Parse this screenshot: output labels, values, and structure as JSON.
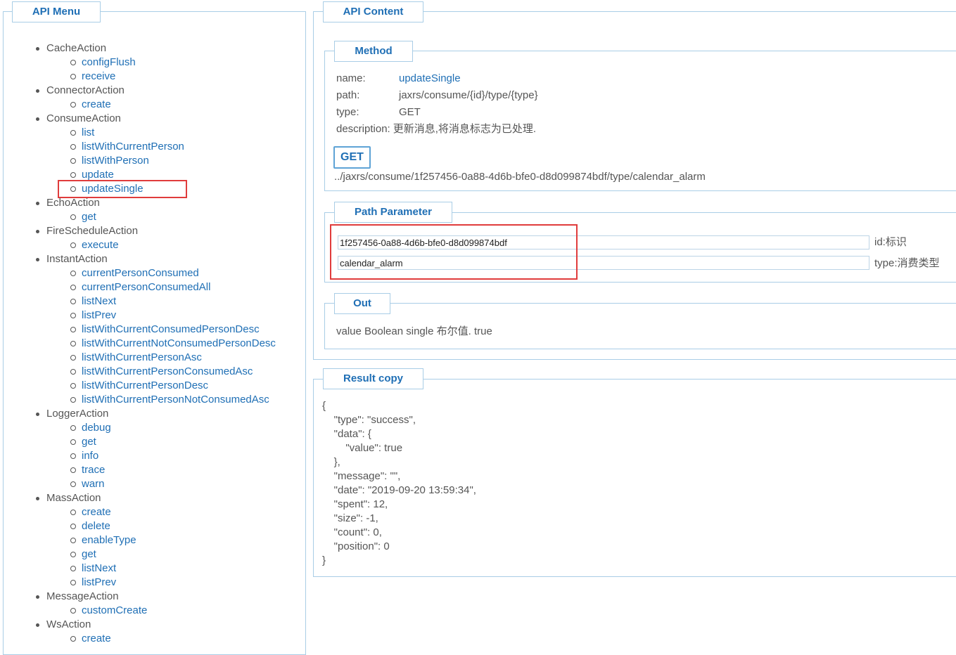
{
  "menu": {
    "title": "API Menu",
    "groups": [
      {
        "label": "CacheAction",
        "items": [
          "configFlush",
          "receive"
        ]
      },
      {
        "label": "ConnectorAction",
        "items": [
          "create"
        ]
      },
      {
        "label": "ConsumeAction",
        "items": [
          "list",
          "listWithCurrentPerson",
          "listWithPerson",
          "update",
          "updateSingle"
        ]
      },
      {
        "label": "EchoAction",
        "items": [
          "get"
        ]
      },
      {
        "label": "FireScheduleAction",
        "items": [
          "execute"
        ]
      },
      {
        "label": "InstantAction",
        "items": [
          "currentPersonConsumed",
          "currentPersonConsumedAll",
          "listNext",
          "listPrev",
          "listWithCurrentConsumedPersonDesc",
          "listWithCurrentNotConsumedPersonDesc",
          "listWithCurrentPersonAsc",
          "listWithCurrentPersonConsumedAsc",
          "listWithCurrentPersonDesc",
          "listWithCurrentPersonNotConsumedAsc"
        ]
      },
      {
        "label": "LoggerAction",
        "items": [
          "debug",
          "get",
          "info",
          "trace",
          "warn"
        ]
      },
      {
        "label": "MassAction",
        "items": [
          "create",
          "delete",
          "enableType",
          "get",
          "listNext",
          "listPrev"
        ]
      },
      {
        "label": "MessageAction",
        "items": [
          "customCreate"
        ]
      },
      {
        "label": "WsAction",
        "items": [
          "create"
        ]
      }
    ]
  },
  "content": {
    "title": "API Content",
    "method": {
      "title": "Method",
      "name_label": "name:",
      "name_value": "updateSingle",
      "path_label": "path:",
      "path_value": "jaxrs/consume/{id}/type/{type}",
      "type_label": "type:",
      "type_value": "GET",
      "description_label": "description:",
      "description_value": "更新消息,将消息标志为已处理.",
      "button_label": "GET",
      "url": "../jaxrs/consume/1f257456-0a88-4d6b-bfe0-d8d099874bdf/type/calendar_alarm"
    },
    "path_parameter": {
      "title": "Path Parameter",
      "params": [
        {
          "value": "1f257456-0a88-4d6b-bfe0-d8d099874bdf",
          "desc": "id:标识"
        },
        {
          "value": "calendar_alarm",
          "desc": "type:消费类型"
        }
      ]
    },
    "out": {
      "title": "Out",
      "text": "value Boolean single 布尔值. true"
    }
  },
  "result": {
    "title": "Result copy",
    "json_text": "{\n    \"type\": \"success\",\n    \"data\": {\n        \"value\": true\n    },\n    \"message\": \"\",\n    \"date\": \"2019-09-20 13:59:34\",\n    \"spent\": 12,\n    \"size\": -1,\n    \"count\": 0,\n    \"position\": 0\n}"
  },
  "colors": {
    "accent": "#1f6fb5",
    "border": "#a9cde6",
    "highlight": "#e03c3c",
    "text": "#555555"
  }
}
